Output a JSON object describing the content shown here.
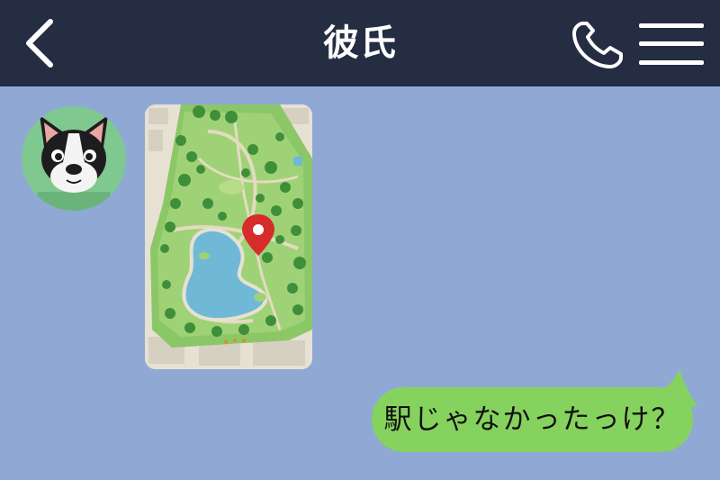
{
  "header": {
    "title": "彼氏",
    "back_icon": "chevron-left-icon",
    "call_icon": "phone-icon",
    "menu_icon": "hamburger-menu-icon",
    "background": "#252d43"
  },
  "chat": {
    "background": "#8fa9d4",
    "incoming": {
      "avatar": "bulldog-avatar",
      "attachment": "park-map-image"
    },
    "outgoing": {
      "text": "駅じゃなかったっけ？",
      "bubble_color": "#86d25e"
    }
  }
}
